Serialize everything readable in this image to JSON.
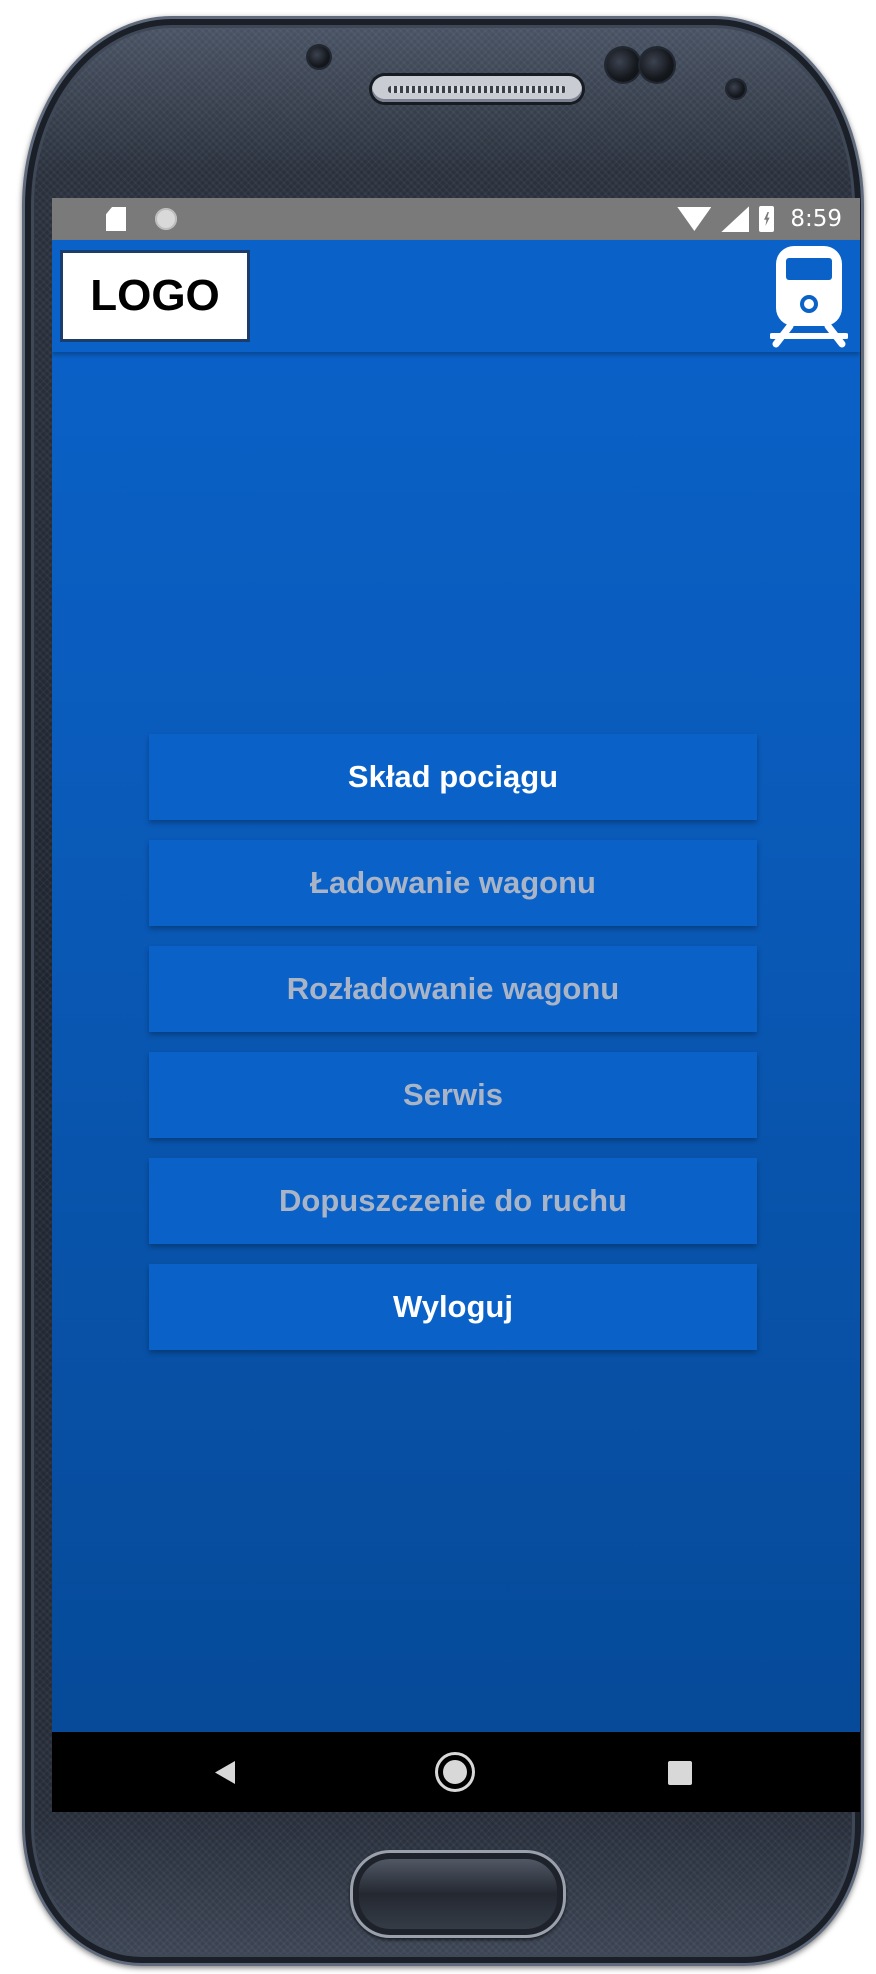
{
  "status_bar": {
    "time": "8:59",
    "left_icons": [
      "sd-card-icon",
      "sync-icon"
    ],
    "right_icons": [
      "wifi-icon",
      "cell-signal-icon",
      "battery-charging-icon"
    ]
  },
  "app_bar": {
    "logo_text": "LOGO",
    "right_icon": "train-icon"
  },
  "menu": {
    "items": [
      {
        "label": "Skład pociągu",
        "enabled": true
      },
      {
        "label": "Ładowanie wagonu",
        "enabled": false
      },
      {
        "label": "Rozładowanie wagonu",
        "enabled": false
      },
      {
        "label": "Serwis",
        "enabled": true
      },
      {
        "label": "Dopuszczenie do ruchu",
        "enabled": false
      },
      {
        "label": "Wyloguj",
        "enabled": true
      }
    ]
  },
  "nav_bar": {
    "icons": [
      "back-icon",
      "home-icon",
      "recent-apps-icon"
    ]
  },
  "colors": {
    "primary": "#0a62c9",
    "enabled_text": "#ffffff",
    "disabled_text": "#a9b4c6",
    "status_bar": "#7a7a7a"
  }
}
